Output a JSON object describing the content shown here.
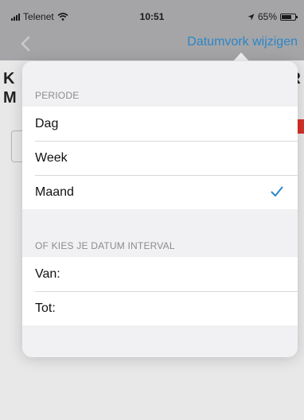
{
  "status_bar": {
    "carrier": "Telenet",
    "time": "10:51",
    "battery": "65%"
  },
  "nav": {
    "action_label": "Datumvork wijzigen"
  },
  "background": {
    "title_left_1": "K",
    "title_left_2": "M",
    "title_right": "R"
  },
  "popover": {
    "periode_header": "PERIODE",
    "periode_items": [
      {
        "label": "Dag",
        "selected": false
      },
      {
        "label": "Week",
        "selected": false
      },
      {
        "label": "Maand",
        "selected": true
      }
    ],
    "interval_header": "OF KIES JE DATUM INTERVAL",
    "interval_items": [
      {
        "label": "Van:"
      },
      {
        "label": "Tot:"
      }
    ]
  },
  "colors": {
    "accent": "#2a86c8",
    "status_red": "#d6312a"
  }
}
